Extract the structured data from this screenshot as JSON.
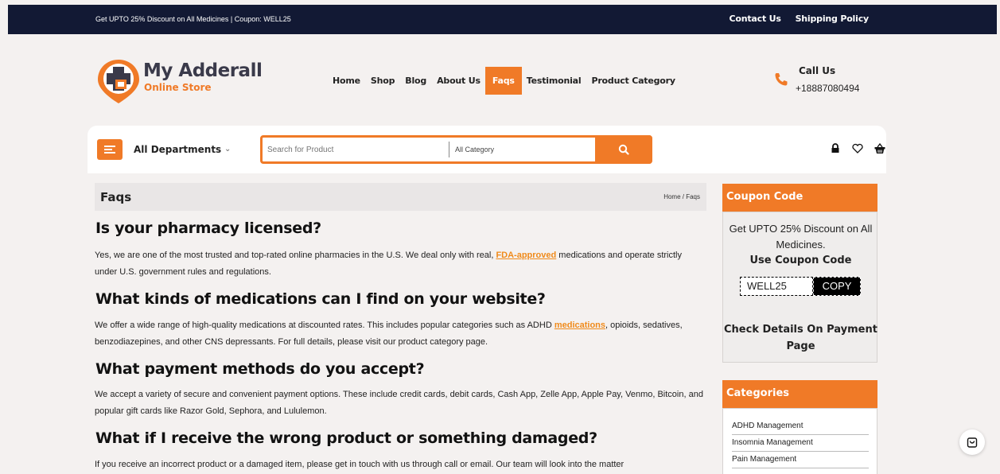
{
  "topbar": {
    "promo": "Get UPTO 25% Discount on All Medicines | Coupon: WELL25",
    "links": [
      "Contact Us",
      "Shipping Policy"
    ]
  },
  "brand": {
    "name": "My Adderall",
    "subtitle": "Online Store",
    "accent": "#f07a27"
  },
  "nav": [
    {
      "label": "Home",
      "active": false
    },
    {
      "label": "Shop",
      "active": false
    },
    {
      "label": "Blog",
      "active": false
    },
    {
      "label": "About Us",
      "active": false
    },
    {
      "label": "Faqs",
      "active": true
    },
    {
      "label": "Testimonial",
      "active": false
    },
    {
      "label": "Product Category",
      "active": false
    }
  ],
  "call": {
    "title": "Call Us",
    "phone": "+18887080494"
  },
  "searchbar": {
    "departments_label": "All Departments",
    "search_placeholder": "Search for Product",
    "category_label": "All Category"
  },
  "page": {
    "title": "Faqs",
    "breadcrumb": "Home / Faqs"
  },
  "faqs": [
    {
      "q": "Is your pharmacy licensed?",
      "a_pre": "Yes, we are one of the most trusted and top-rated online pharmacies in the U.S. We deal only with real, ",
      "a_link": "FDA-approved",
      "a_post": " medications and operate strictly under U.S. government rules and regulations."
    },
    {
      "q": "What kinds of medications can I find on your website?",
      "a_pre": "We offer a wide range of high-quality medications at discounted rates. This includes popular categories such as ADHD ",
      "a_link": "medications",
      "a_post": ", opioids, sedatives, benzodiazepines, and other CNS depressants. For full details, please visit our product category page."
    },
    {
      "q": "What payment methods do you accept?",
      "a_pre": "We accept a variety of secure and convenient payment options. These include credit cards, debit cards, Cash App, Zelle App, Apple Pay, Venmo, Bitcoin, and popular gift cards like Razor Gold, Sephora, and Lululemon.",
      "a_link": "",
      "a_post": ""
    },
    {
      "q": "What if I receive the wrong product or something damaged?",
      "a_pre": "If you receive an incorrect product or a damaged item, please get in touch with us through call or email. Our team will look into the matter",
      "a_link": "",
      "a_post": ""
    }
  ],
  "coupon": {
    "heading": "Coupon Code",
    "line1": "Get UPTO 25% Discount on All Medicines.",
    "line2": "Use Coupon Code",
    "code": "WELL25",
    "copy_label": "COPY",
    "line3": "Check Details On Payment Page"
  },
  "categories": {
    "heading": "Categories",
    "items": [
      "ADHD Management",
      "Insomnia Management",
      "Pain Management"
    ]
  }
}
